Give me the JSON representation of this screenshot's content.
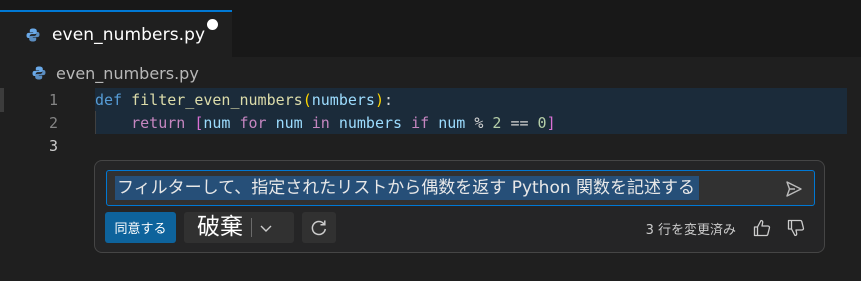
{
  "tab": {
    "title": "even_numbers.py",
    "icon": "python-file-icon",
    "modified": true
  },
  "breadcrumb": {
    "file": "even_numbers.py"
  },
  "editor": {
    "line_numbers": [
      "1",
      "2",
      "3"
    ],
    "active_line": "3",
    "line1": {
      "def": "def",
      "fname": "filter_even_numbers",
      "open": "(",
      "param": "numbers",
      "close": ")",
      "colon": ":"
    },
    "line2": {
      "ret": "return",
      "lb": "[",
      "v1": "num",
      "for": "for",
      "v2": "num",
      "in": "in",
      "v3": "numbers",
      "if": "if",
      "v4": "num",
      "mod": "%",
      "two": "2",
      "eq": "==",
      "zero": "0",
      "rb": "]"
    }
  },
  "inline_chat": {
    "prompt": "フィルターして、指定されたリストから偶数を返す Python 関数を記述する",
    "accept_label": "同意する",
    "discard_label": "破棄",
    "status": "3 行を変更済み",
    "icons": [
      "send-icon",
      "chevron-down-icon",
      "refresh-icon",
      "thumbs-up-icon",
      "thumbs-down-icon"
    ]
  },
  "colors": {
    "accent": "#0078d4",
    "accept_button": "#0e639c",
    "diff_background": "#1b2b3a",
    "selection": "#264f78"
  }
}
